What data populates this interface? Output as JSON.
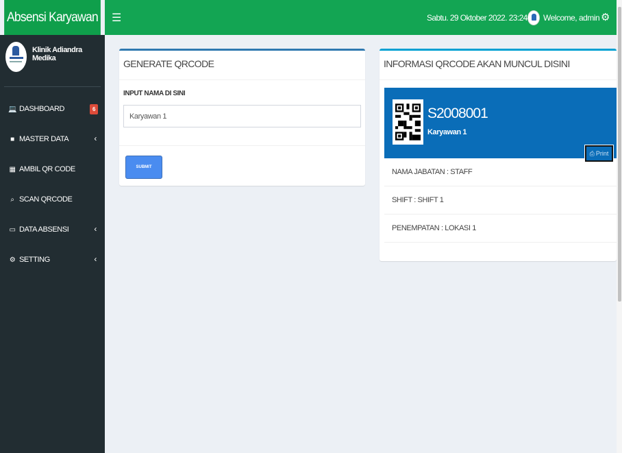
{
  "header": {
    "brand": "Absensi Karyawan",
    "menu_icon": "hamburger-icon",
    "datetime": "Sabtu. 29 Oktober 2022. 23:24:54",
    "welcome": "Welcome, admin",
    "settings_icon": "cogs-icon"
  },
  "sidebar": {
    "clinic_name": "Klinik Adiandra Medika",
    "items": [
      {
        "label": "DASHBOARD",
        "icon": "laptop-icon",
        "badge": "6"
      },
      {
        "label": "MASTER DATA",
        "icon": "folder-icon"
      },
      {
        "label": "AMBIL QR CODE",
        "icon": "qrcode-icon"
      },
      {
        "label": "SCAN QRCODE",
        "icon": "search-icon"
      },
      {
        "label": "DATA ABSENSI",
        "icon": "folder-open-icon"
      },
      {
        "label": "SETTING",
        "icon": "cogs-icon"
      }
    ]
  },
  "generate": {
    "title": "GENERATE QRCODE",
    "input_label": "INPUT NAMA DI SINI",
    "input_value": "Karyawan 1",
    "submit_label": "SUBMIT"
  },
  "info": {
    "title": "INFORMASI QRCODE AKAN MUNCUL DISINI",
    "code": "S2008001",
    "name": "Karyawan 1",
    "print_label": "Print",
    "rows": [
      "NAMA JABATAN : STAFF",
      "SHIFT : SHIFT 1",
      "PENEMPATAN : LOKASI 1"
    ]
  },
  "colors": {
    "header_green": "#13a553",
    "sidebar_dark": "#222d32",
    "widget_blue": "#0a6db8",
    "submit_blue": "#4a8cf0",
    "badge_red": "#dd4b39"
  }
}
